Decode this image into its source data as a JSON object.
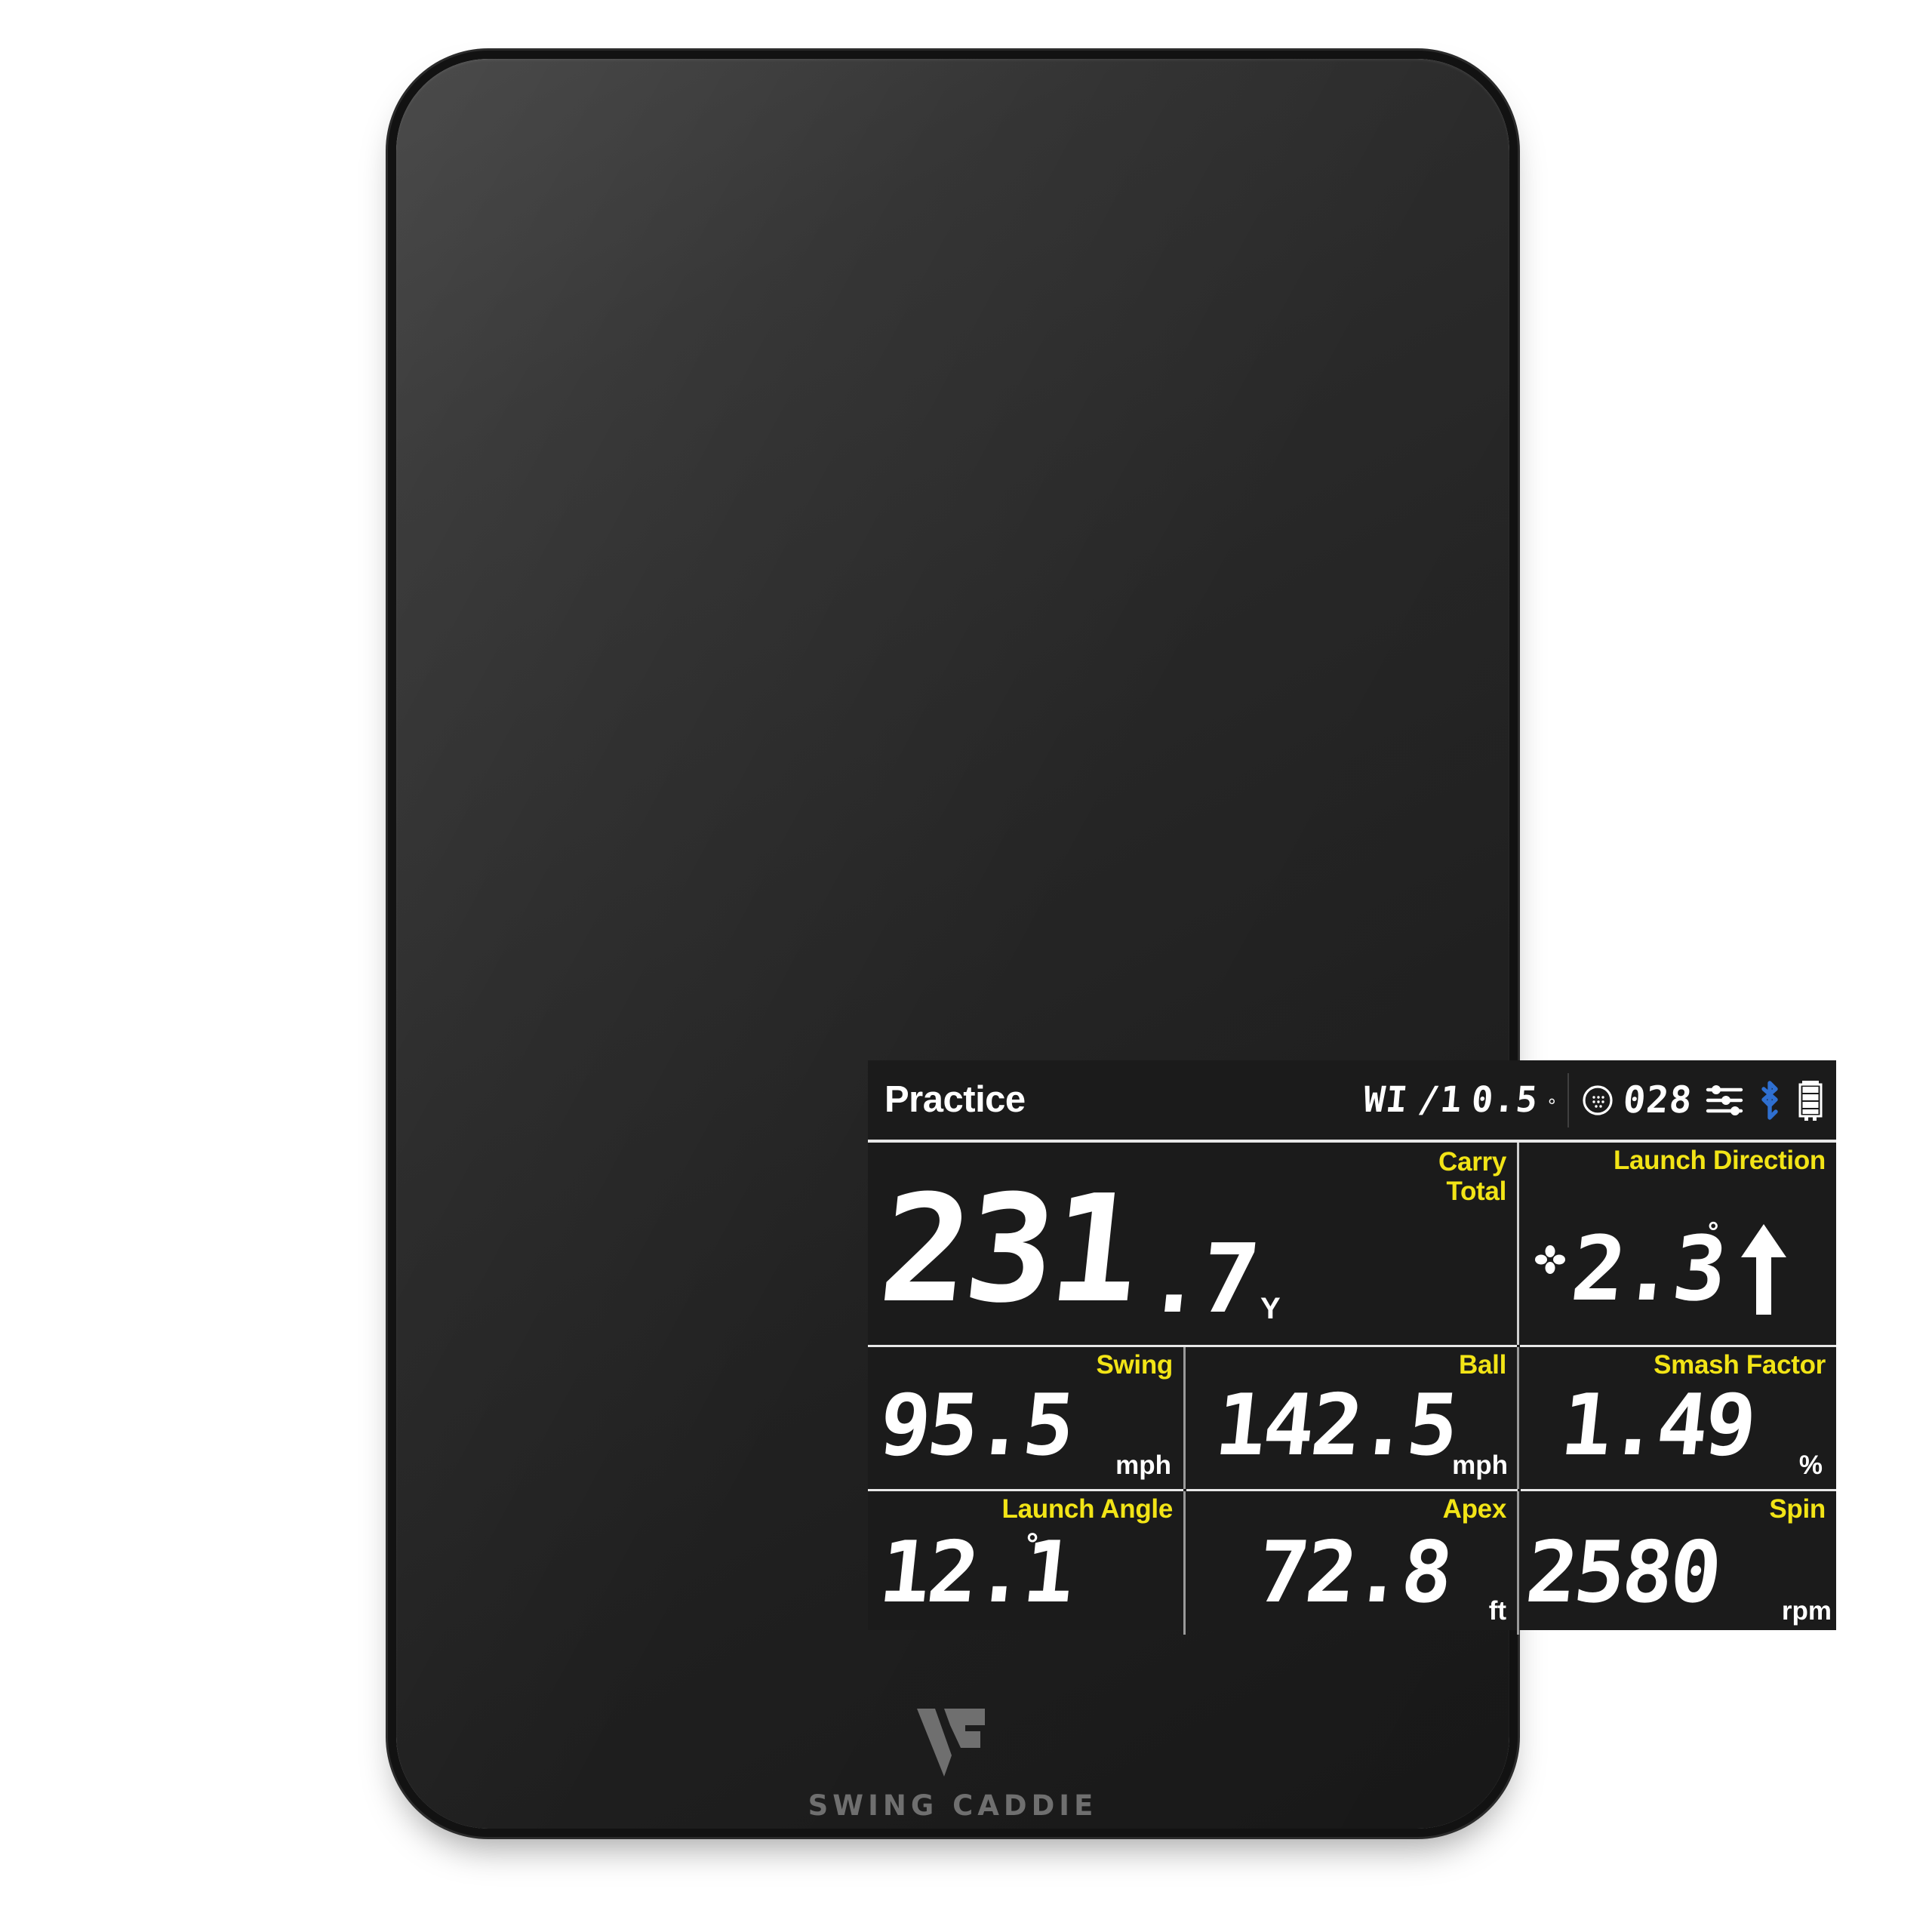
{
  "device": {
    "brand_logo_text": "SWING CADDIE",
    "logo_mark": "vc-monogram-logo"
  },
  "screen": {
    "status": {
      "mode_label": "Practice",
      "wind": {
        "direction_code": "WI",
        "slash": "/1",
        "speed": "0.5",
        "degree_symbol": "°"
      },
      "ball_icon": "golf-ball-icon",
      "shot_count": "028",
      "sliders_icon": "sliders-settings-icon",
      "bluetooth_icon": "bluetooth-icon",
      "battery_icon": "battery-full-icon",
      "bluetooth_color": "#2f6fd0"
    },
    "cells": {
      "carry": {
        "label_line1": "Carry",
        "label_line2": "Total",
        "value_int": "231",
        "value_dec": ".7",
        "unit": "Y"
      },
      "launch_direction": {
        "label": "Launch Direction",
        "value": "2.3",
        "degree_symbol": "°",
        "cross_icon": "direction-cross-icon",
        "arrow_icon": "arrow-up-icon"
      },
      "swing": {
        "label": "Swing",
        "value": "95.5",
        "unit": "mph"
      },
      "ball": {
        "label": "Ball",
        "value": "142.5",
        "unit": "mph"
      },
      "smash_factor": {
        "label": "Smash Factor",
        "value": "1.49",
        "unit": "%"
      },
      "launch_angle": {
        "label": "Launch Angle",
        "value": "12.1",
        "unit": "°"
      },
      "apex": {
        "label": "Apex",
        "value": "72.8",
        "unit": "ft"
      },
      "spin": {
        "label": "Spin",
        "value": "2580",
        "unit": "rpm"
      }
    },
    "colors": {
      "label_yellow": "#f2e416",
      "value_white": "#ffffff",
      "lcd_background": "#1b1b1b",
      "divider": "#e8e8e8"
    }
  }
}
